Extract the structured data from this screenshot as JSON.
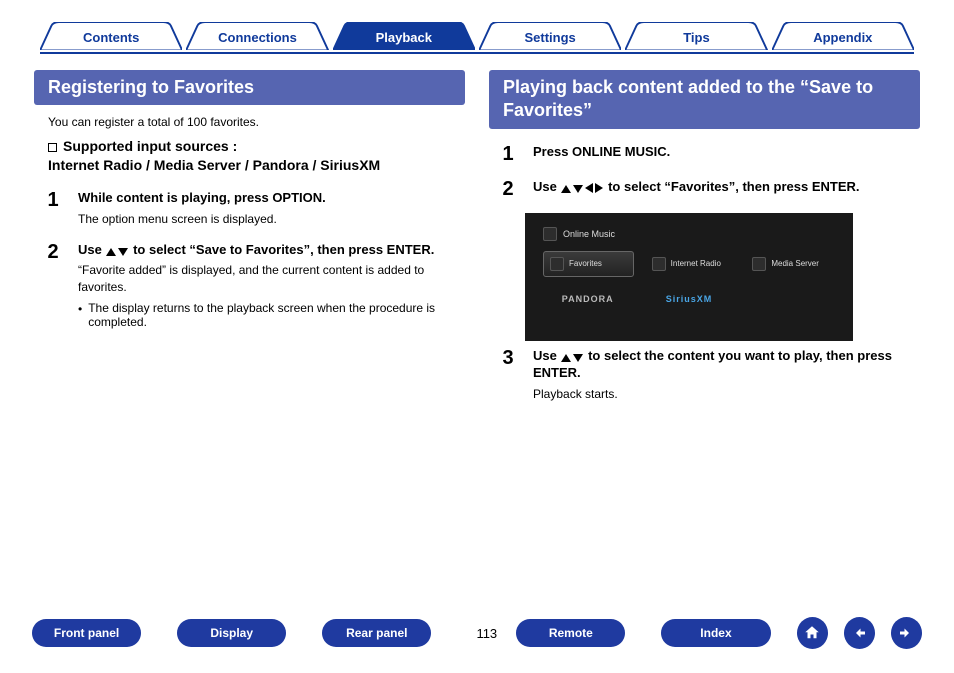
{
  "tabs": {
    "items": [
      {
        "label": "Contents",
        "active": false
      },
      {
        "label": "Connections",
        "active": false
      },
      {
        "label": "Playback",
        "active": true
      },
      {
        "label": "Settings",
        "active": false
      },
      {
        "label": "Tips",
        "active": false
      },
      {
        "label": "Appendix",
        "active": false
      }
    ]
  },
  "left": {
    "title": "Registering to Favorites",
    "note": "You can register a total of 100 favorites.",
    "supported_label": "Supported input sources :",
    "supported_sources": "Internet Radio / Media Server / Pandora / SiriusXM",
    "steps": [
      {
        "num": "1",
        "head": "While content is playing, press OPTION.",
        "text": "The option menu screen is displayed."
      },
      {
        "num": "2",
        "head_pre": "Use ",
        "head_post": " to select “Save to Favorites”, then press ENTER.",
        "text": "“Favorite added” is displayed, and the current content is added to favorites.",
        "sub": "The display returns to the playback screen when the procedure is completed."
      }
    ]
  },
  "right": {
    "title": "Playing back content added to the “Save to Favorites”",
    "steps": [
      {
        "num": "1",
        "head": "Press ONLINE MUSIC."
      },
      {
        "num": "2",
        "head_pre": "Use ",
        "head_post": " to select “Favorites”, then press ENTER."
      },
      {
        "num": "3",
        "head_pre": "Use ",
        "head_post": " to select the content you want to play, then press ENTER.",
        "text": "Playback starts."
      }
    ],
    "mini": {
      "title": "Online Music",
      "row1": [
        "Favorites",
        "Internet Radio",
        "Media Server"
      ],
      "row2": [
        "PANDORA",
        "SiriusXM"
      ]
    }
  },
  "bottom": {
    "buttons": [
      "Front panel",
      "Display",
      "Rear panel"
    ],
    "page": "113",
    "buttons_right": [
      "Remote",
      "Index"
    ]
  }
}
